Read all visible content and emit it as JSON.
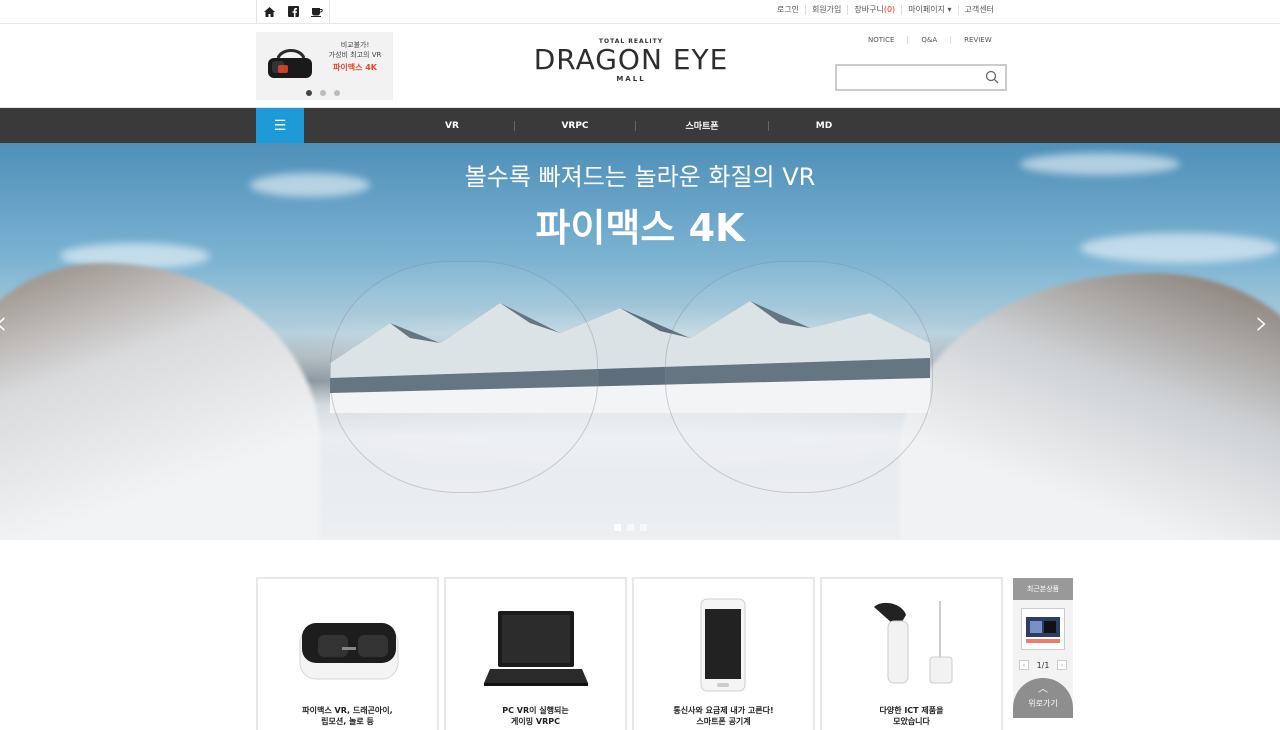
{
  "topbar": {
    "icons": [
      "home-icon",
      "facebook-icon",
      "kakao-story-icon"
    ],
    "util": [
      {
        "label": "로그인"
      },
      {
        "label": "회원가입"
      },
      {
        "label": "장바구니",
        "count": "(0)"
      },
      {
        "label": "마이페이지 ▾"
      },
      {
        "label": "고객센터"
      }
    ]
  },
  "promo": {
    "line1": "비교불가!",
    "line2": "가성비 최고의 VR",
    "product": "파이맥스 4K"
  },
  "logo": {
    "top": "TOTAL REALITY",
    "name": "DRAGON EYE",
    "bottom": "MALL"
  },
  "header_links": [
    "NOTICE",
    "Q&A",
    "REVIEW"
  ],
  "search": {
    "placeholder": ""
  },
  "nav": {
    "menu_icon": "hamburger-icon",
    "items": [
      "VR",
      "VRPC",
      "스마트폰",
      "MD"
    ]
  },
  "hero": {
    "subtitle": "볼수록 빠져드는 놀라운 화질의 VR",
    "title": "파이맥스 4K"
  },
  "products": [
    {
      "line1": "파이맥스 VR, 드래곤아이,",
      "line2": "립모션, 놀로 등"
    },
    {
      "line1": "PC VR이 실행되는",
      "line2": "게이밍 VRPC"
    },
    {
      "line1": "통신사와 요금제 내가 고른다!",
      "line2": "스마트폰 공기계"
    },
    {
      "line1": "다양한 ICT 제품을",
      "line2": "모았습니다"
    }
  ],
  "recent": {
    "title": "최근본상품",
    "page": "1/1",
    "top_label": "위로가기"
  },
  "colors": {
    "nav_bg": "#3a3a3a",
    "menu_accent": "#1e9ad6",
    "promo_red": "#e8452c"
  }
}
